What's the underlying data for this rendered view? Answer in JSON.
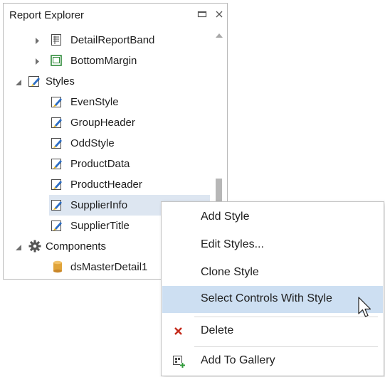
{
  "panel": {
    "title": "Report Explorer",
    "pin_icon": "window-minimize-icon",
    "close_icon": "close-icon"
  },
  "tree": {
    "items": [
      {
        "label": "DetailReportBand",
        "icon": "detail-report-band-icon",
        "expander": "collapsed"
      },
      {
        "label": "BottomMargin",
        "icon": "bottom-margin-icon",
        "expander": "collapsed"
      },
      {
        "label": "Styles",
        "icon": "styles-folder-icon",
        "expander": "expanded"
      },
      {
        "label": "EvenStyle",
        "icon": "style-icon"
      },
      {
        "label": "GroupHeader",
        "icon": "style-icon"
      },
      {
        "label": "OddStyle",
        "icon": "style-icon"
      },
      {
        "label": "ProductData",
        "icon": "style-icon"
      },
      {
        "label": "ProductHeader",
        "icon": "style-icon"
      },
      {
        "label": "SupplierInfo",
        "icon": "style-icon",
        "selected": true
      },
      {
        "label": "SupplierTitle",
        "icon": "style-icon"
      },
      {
        "label": "Components",
        "icon": "components-gear-icon",
        "expander": "expanded"
      },
      {
        "label": "dsMasterDetail1",
        "icon": "database-icon"
      }
    ]
  },
  "context_menu": {
    "items": [
      {
        "label": "Add Style",
        "icon": ""
      },
      {
        "label": "Edit Styles...",
        "icon": ""
      },
      {
        "label": "Clone Style",
        "icon": ""
      },
      {
        "label": "Select Controls With Style",
        "icon": "",
        "highlighted": true
      },
      {
        "label": "Delete",
        "icon": "delete-x-icon"
      },
      {
        "label": "Add To Gallery",
        "icon": "add-to-gallery-icon"
      }
    ]
  },
  "colors": {
    "selection": "#dde6f1",
    "menu_highlight": "#cddff2",
    "delete_red": "#c42b1c",
    "style_icon_blue": "#2e6fc5"
  }
}
